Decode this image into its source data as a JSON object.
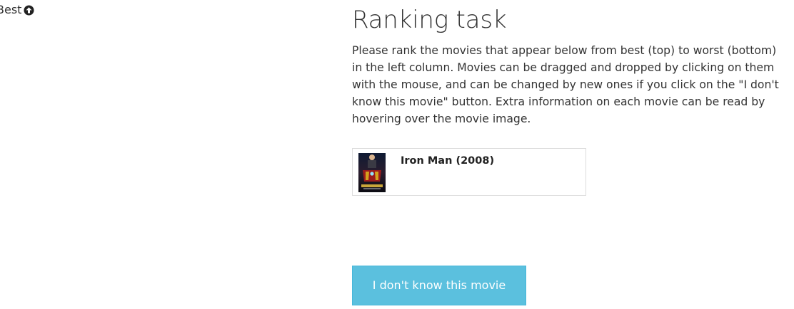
{
  "ranking": {
    "best_label": "Best",
    "best_icon": "arrow-circle-up-icon"
  },
  "main": {
    "title": "Ranking task",
    "instructions": "Please rank the movies that appear below from best (top) to worst (bottom) in the left column. Movies can be dragged and dropped by clicking on them with the mouse, and can be changed by new ones if you click on the \"I don't know this movie\" button. Extra information on each movie can be read by hovering over the movie image."
  },
  "movies": [
    {
      "title": "Iron Man (2008)",
      "poster_icon": "movie-poster-image"
    }
  ],
  "buttons": {
    "unknown_label": "I don't know this movie"
  },
  "colors": {
    "button_bg": "#5bc0de",
    "button_border": "#46b8da",
    "button_text": "#ffffff",
    "card_border": "#dddddd",
    "text": "#333333"
  }
}
